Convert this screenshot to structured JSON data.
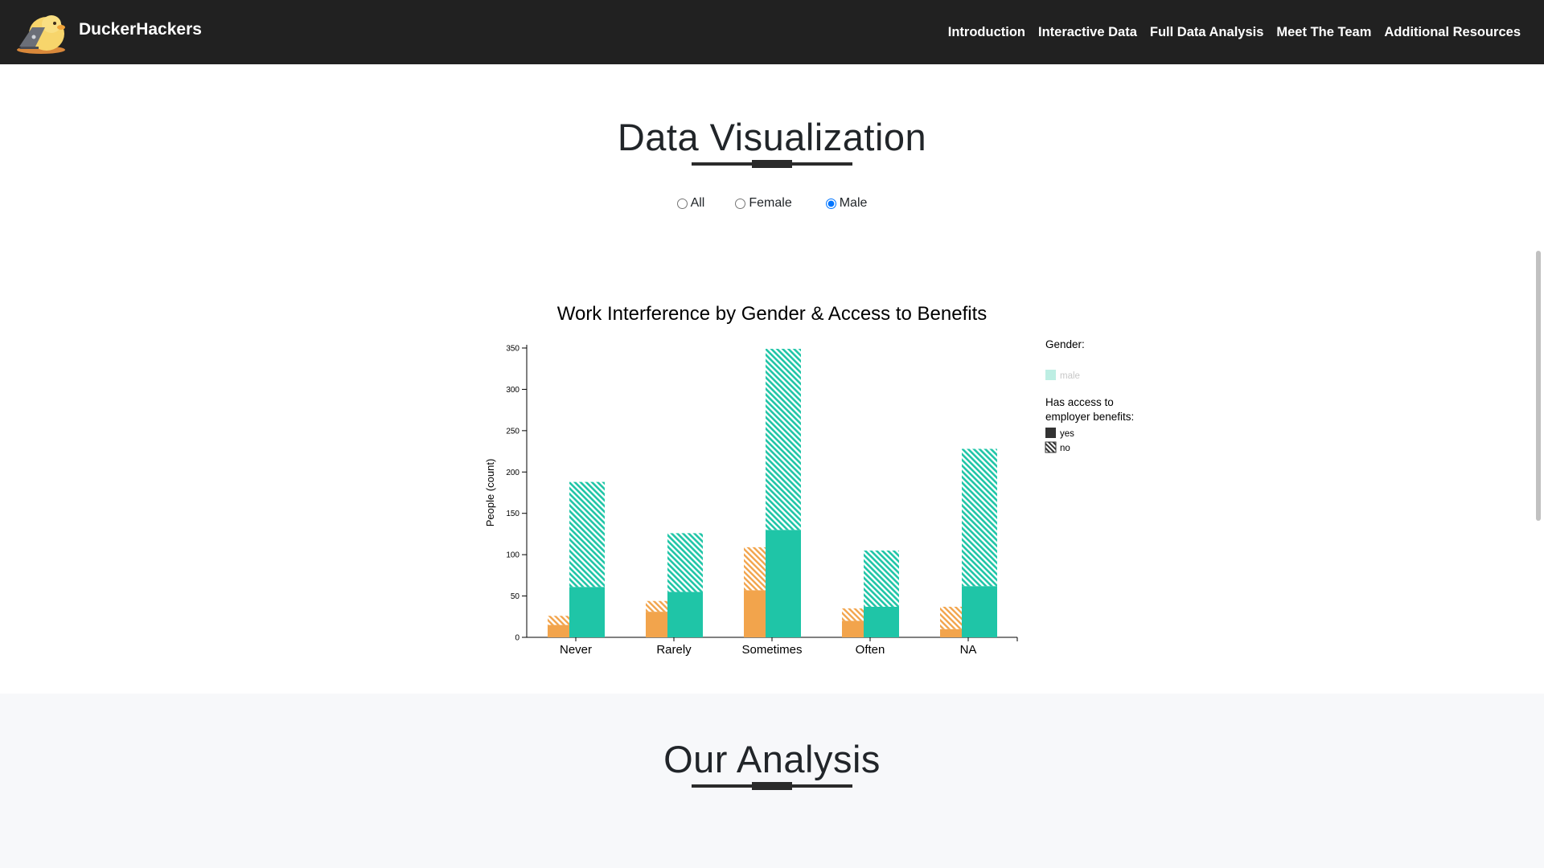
{
  "brand": {
    "name": "DuckerHackers",
    "logo_icon": "duck-laptop-logo"
  },
  "nav": {
    "items": [
      {
        "label": "Introduction"
      },
      {
        "label": "Interactive Data"
      },
      {
        "label": "Full Data Analysis"
      },
      {
        "label": "Meet The Team"
      },
      {
        "label": "Additional Resources"
      }
    ]
  },
  "viz_section": {
    "title": "Data Visualization"
  },
  "filter": {
    "options": [
      {
        "label": "All",
        "checked": false
      },
      {
        "label": "Female",
        "checked": false
      },
      {
        "label": "Male",
        "checked": true
      }
    ]
  },
  "analysis_section": {
    "title": "Our Analysis"
  },
  "colors": {
    "female": "#f2a44c",
    "male": "#1fc5a7",
    "navbar": "#212121",
    "legend_male": "#bdeee3",
    "legend_box": "#333333"
  },
  "chart_data": {
    "type": "bar",
    "title": "Work Interference by Gender & Access to Benefits",
    "ylabel": "People (count)",
    "xlabel": "",
    "ylim": [
      0,
      350
    ],
    "yticks": [
      0,
      50,
      100,
      150,
      200,
      250,
      300,
      350
    ],
    "categories": [
      "Never",
      "Rarely",
      "Sometimes",
      "Often",
      "NA"
    ],
    "stacked_within_group": true,
    "series": [
      {
        "name": "female",
        "yes": [
          15,
          31,
          57,
          20,
          10
        ],
        "no": [
          11,
          13,
          52,
          15,
          27
        ]
      },
      {
        "name": "male",
        "yes": [
          61,
          55,
          130,
          37,
          62
        ],
        "no": [
          127,
          71,
          219,
          68,
          166
        ]
      }
    ],
    "legend": {
      "gender_title": "Gender:",
      "gender_items": [
        "male"
      ],
      "benefits_title_line1": "Has access to",
      "benefits_title_line2": "employer benefits:",
      "benefits_items": [
        "yes",
        "no"
      ],
      "position": "right"
    },
    "grid": false
  }
}
